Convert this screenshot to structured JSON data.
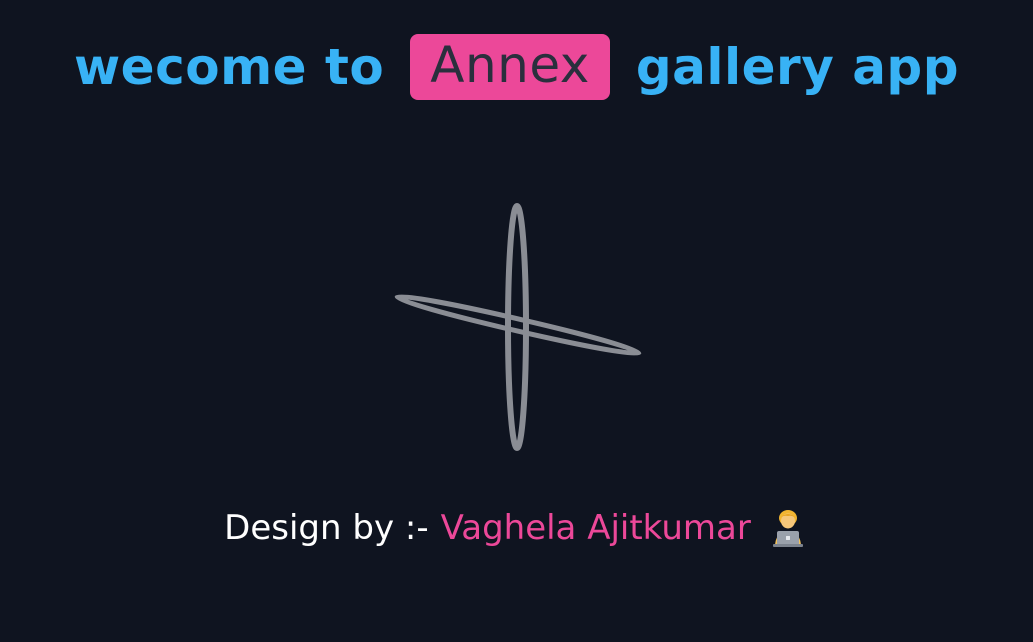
{
  "header": {
    "prefix": "wecome to",
    "brand": "Annex",
    "suffix": "gallery app"
  },
  "loader": {
    "icon": "spinning-rings-loader-icon",
    "color": "#8a8d94"
  },
  "credit": {
    "prefix": "Design by :-",
    "author": "Vaghela Ajitkumar",
    "emoji_icon": "technologist-emoji-icon"
  },
  "colors": {
    "background": "#0f1420",
    "title_blue": "#38b2f5",
    "brand_pink": "#ec4899",
    "brand_text": "#2a2f3d",
    "white": "#ffffff"
  }
}
